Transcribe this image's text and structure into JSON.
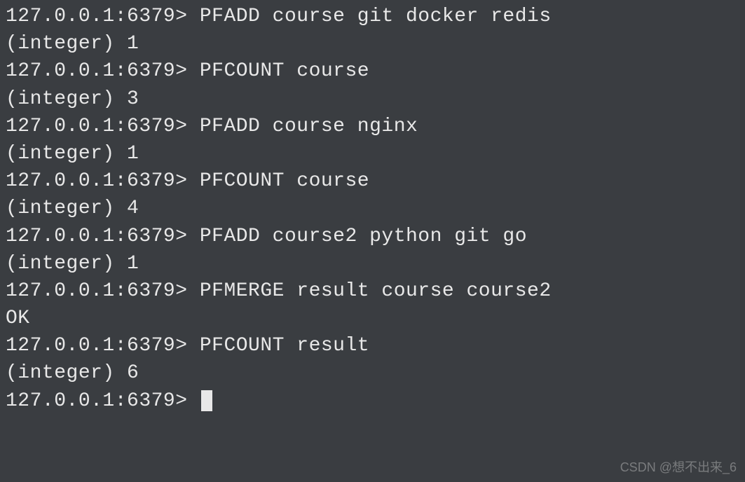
{
  "prompt": "127.0.0.1:6379> ",
  "lines": [
    {
      "text": "127.0.0.1:6379> PFADD course git docker redis"
    },
    {
      "text": "(integer) 1"
    },
    {
      "text": "127.0.0.1:6379> PFCOUNT course"
    },
    {
      "text": "(integer) 3"
    },
    {
      "text": "127.0.0.1:6379> PFADD course nginx"
    },
    {
      "text": "(integer) 1"
    },
    {
      "text": "127.0.0.1:6379> PFCOUNT course"
    },
    {
      "text": "(integer) 4"
    },
    {
      "text": "127.0.0.1:6379> PFADD course2 python git go"
    },
    {
      "text": "(integer) 1"
    },
    {
      "text": "127.0.0.1:6379> PFMERGE result course course2"
    },
    {
      "text": "OK"
    },
    {
      "text": "127.0.0.1:6379> PFCOUNT result"
    },
    {
      "text": "(integer) 6"
    }
  ],
  "watermark": "CSDN @想不出来_6"
}
